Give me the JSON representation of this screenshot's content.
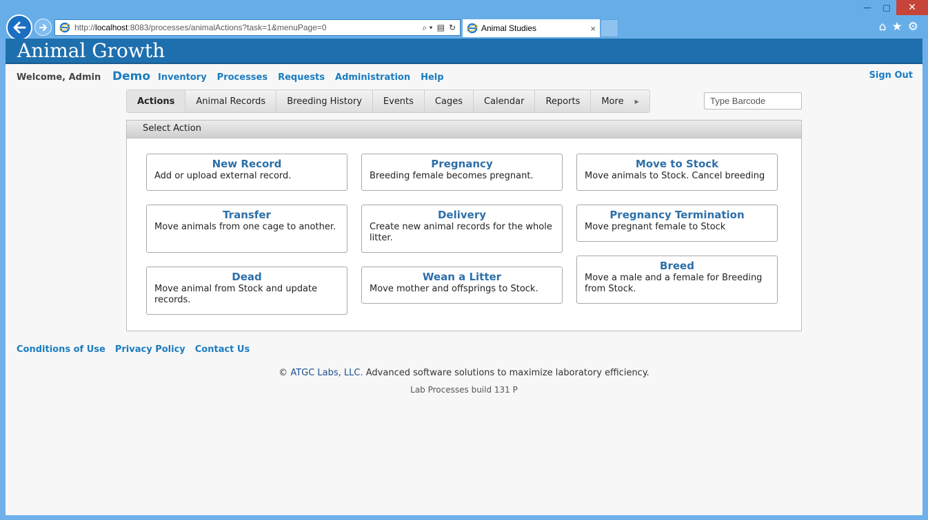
{
  "browser": {
    "url_prefix": "http://",
    "url_host": "localhost",
    "url_rest": ":8083/processes/animalActions?task=1&menuPage=0",
    "tab_title": "Animal Studies",
    "tab_close": "×",
    "window_min": "—",
    "window_max": "□",
    "window_close": "✕",
    "search_glyph": "⌕ ▾",
    "compat_glyph": "▤",
    "refresh_glyph": "↻",
    "home_glyph": "⌂",
    "fav_glyph": "★",
    "settings_glyph": "⚙"
  },
  "app": {
    "title": "Animal Growth",
    "welcome": "Welcome, Admin",
    "demo": "Demo",
    "menu": [
      "Inventory",
      "Processes",
      "Requests",
      "Administration",
      "Help"
    ],
    "sign_out": "Sign Out"
  },
  "tabs": [
    "Actions",
    "Animal Records",
    "Breeding History",
    "Events",
    "Cages",
    "Calendar",
    "Reports",
    "More"
  ],
  "barcode_placeholder": "Type Barcode",
  "panel_title": "Select Action",
  "actions": [
    {
      "title": "New Record",
      "desc": "Add or upload external record."
    },
    {
      "title": "Pregnancy",
      "desc": "Breeding female becomes pregnant."
    },
    {
      "title": "Move to Stock",
      "desc": "Move animals to Stock. Cancel breeding"
    },
    {
      "title": "Transfer",
      "desc": "Move animals from one cage to another."
    },
    {
      "title": "Delivery",
      "desc": "Create new animal records for the whole litter."
    },
    {
      "title": "Pregnancy Termination",
      "desc": "Move pregnant female to Stock"
    },
    {
      "title": "Dead",
      "desc": "Move animal from Stock and update records."
    },
    {
      "title": "Wean a Litter",
      "desc": "Move mother and offsprings to Stock."
    },
    {
      "title": "Breed",
      "desc": "Move a male and a female for Breeding from Stock."
    }
  ],
  "footer": {
    "links": [
      "Conditions of Use",
      "Privacy Policy",
      "Contact Us"
    ],
    "copyright_symbol": "©",
    "company": "ATGC Labs, LLC.",
    "tagline": "Advanced software solutions to maximize laboratory efficiency.",
    "build": "Lab Processes build 131 P"
  },
  "colors": {
    "banner": "#1e6fae",
    "link": "#1a7cc0",
    "card_title": "#2d6fa8"
  }
}
